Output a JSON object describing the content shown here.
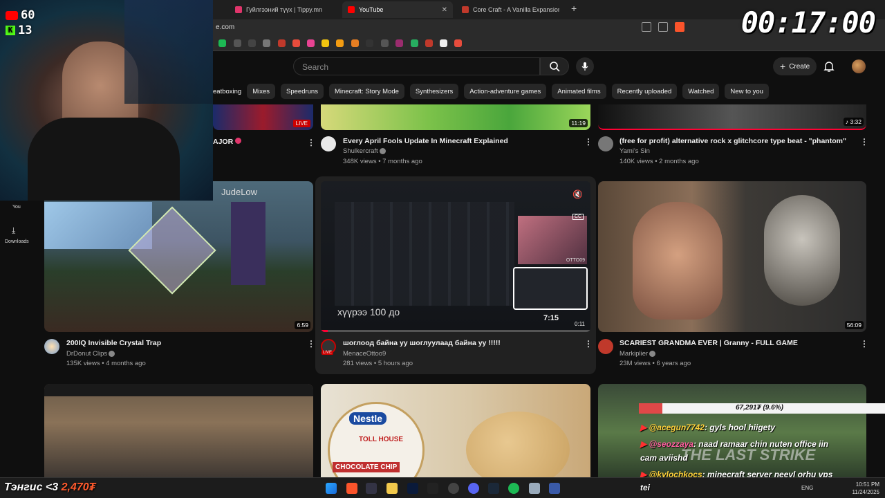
{
  "browser": {
    "tabs": [
      {
        "label": "Гуйлгээний түүх | Tippy.mn"
      },
      {
        "label": "YouTube"
      },
      {
        "label": "Core Craft - A Vanilla Expansion - Mi"
      }
    ],
    "url": "e.com",
    "new_tab": "+"
  },
  "header": {
    "search_placeholder": "Search",
    "create_label": "Create"
  },
  "chips": [
    "eatboxing",
    "Mixes",
    "Speedruns",
    "Minecraft: Story Mode",
    "Synthesizers",
    "Action-adventure games",
    "Animated films",
    "Recently uploaded",
    "Watched",
    "New to you"
  ],
  "sidenav": {
    "you": "You",
    "downloads": "Downloads"
  },
  "row1": [
    {
      "title": "AJOR",
      "live": "LIVE"
    },
    {
      "title": "Every April Fools Update In Minecraft Explained",
      "channel": "Shulkercraft",
      "meta": "348K views • 7 months ago",
      "duration": "11:19"
    },
    {
      "title": "(free for profit) alternative rock x glitchcore type beat - \"phantom\"",
      "channel": "Yami's Sin",
      "meta": "140K views • 2 months ago",
      "duration": "♪ 3:32"
    }
  ],
  "row2": [
    {
      "title": "200IQ Invisible Crystal Trap",
      "channel": "DrDonut Clips",
      "meta": "135K views • 4 months ago",
      "duration": "6:59",
      "overlay_name": "JudeLow"
    },
    {
      "title": "шоглоод байна уу шоглуулаад байна уу !!!!!",
      "channel": "MenaceOttoo9",
      "meta": "281 views • 5 hours ago",
      "live": "LIVE",
      "caption": "хүүрээ 100 до",
      "preview_time": "7:15",
      "progress_time": "0:11",
      "cc": "CC",
      "preview_tag": "OTTO09"
    },
    {
      "title": "SCARIEST GRANDMA EVER | Granny - FULL GAME",
      "channel": "Markiplier",
      "meta": "23M views • 6 years ago",
      "duration": "56:09"
    }
  ],
  "overlay": {
    "youtube_count": "60",
    "kick_count": "13",
    "timer": "00:17:00",
    "donation_name": "Тэнгис <3",
    "donation_amount": "2,470₮",
    "goal_text": "67,291₮ (9.6%)",
    "chat": [
      {
        "user": "@acegun7742",
        "text": ": gyls hool hiigety"
      },
      {
        "user": "@seozzaya",
        "text": ": naad ramaar chin nuten office iin"
      },
      {
        "user": "",
        "text": "cam aviishd"
      },
      {
        "user": "@kylochkocs",
        "text": ": minecraft server neevl orhu vps"
      },
      {
        "user": "",
        "text": "tei"
      }
    ]
  },
  "thumb3_text": "THE LAST STRIKE",
  "nestle": {
    "brand": "Nestle",
    "product": "TOLL HOUSE",
    "flavor": "CHOCOLATE CHIP"
  },
  "tray": {
    "lang": "ENG",
    "time": "10:51 PM",
    "date": "11/24/2025"
  },
  "colors": {
    "bg": "#0f0f0f",
    "chip": "#272727",
    "live_red": "#cc0000",
    "progress_red": "#ff0033"
  }
}
